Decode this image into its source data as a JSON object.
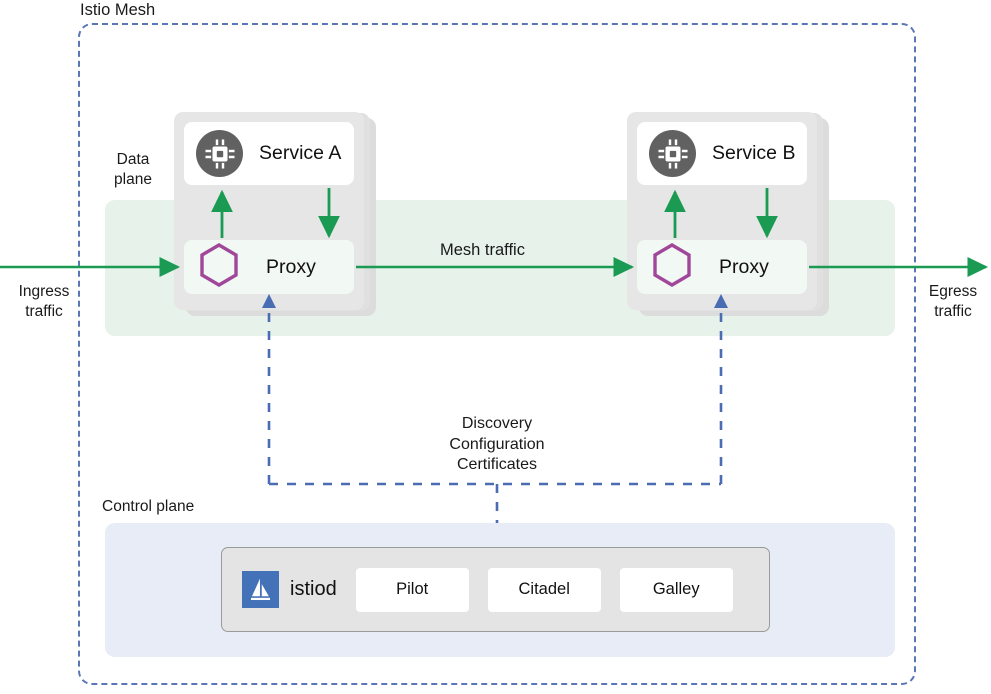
{
  "diagram": {
    "title": "Istio Mesh",
    "mesh_border_color": "#5b76b7"
  },
  "data_plane": {
    "label": "Data\nplane",
    "label_line1": "Data",
    "label_line2": "plane",
    "band_color": "#e6f2ea"
  },
  "pods": [
    {
      "id": "pod-a",
      "service": {
        "label": "Service A",
        "icon": "cpu-chip-icon",
        "icon_bg": "#616161"
      },
      "proxy": {
        "label": "Proxy",
        "icon": "hexagon-icon",
        "icon_color": "#a0479a"
      }
    },
    {
      "id": "pod-b",
      "service": {
        "label": "Service B",
        "icon": "cpu-chip-icon",
        "icon_bg": "#616161"
      },
      "proxy": {
        "label": "Proxy",
        "icon": "hexagon-icon",
        "icon_color": "#a0479a"
      }
    }
  ],
  "traffic": {
    "ingress_line1": "Ingress",
    "ingress_line2": "traffic",
    "egress_line1": "Egress",
    "egress_line2": "traffic",
    "mesh_label": "Mesh traffic",
    "arrow_color": "#1a9a52"
  },
  "control_channel": {
    "line1": "Discovery",
    "line2": "Configuration",
    "line3": "Certificates",
    "line_color": "#4a6cb3"
  },
  "control_plane": {
    "label": "Control plane",
    "band_color": "#e8ecf6",
    "istiod": {
      "name": "istiod",
      "logo": "istio-sailboat-icon",
      "logo_bg": "#4472b8"
    },
    "components": [
      {
        "label": "Pilot"
      },
      {
        "label": "Citadel"
      },
      {
        "label": "Galley"
      }
    ]
  }
}
